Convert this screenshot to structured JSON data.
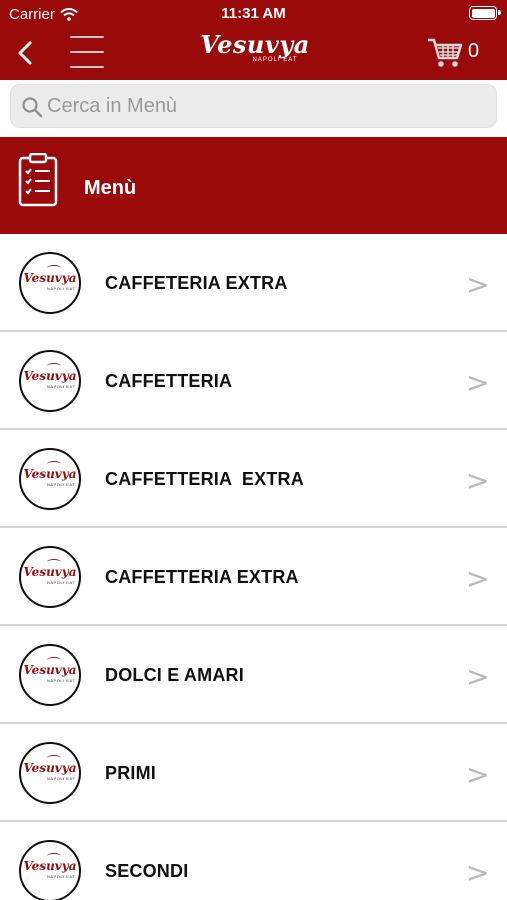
{
  "status_bar": {
    "carrier": "Carrier",
    "time": "11:31 AM"
  },
  "nav": {
    "logo_text": "Vesuvya",
    "logo_subtext": "NAPOLI EAT",
    "cart_count": "0"
  },
  "search": {
    "placeholder": "Cerca in Menù"
  },
  "menu_header": {
    "title": "Menù"
  },
  "categories": [
    {
      "label": "CAFFETERIA EXTRA"
    },
    {
      "label": "CAFFETTERIA"
    },
    {
      "label": "CAFFETTERIA  EXTRA"
    },
    {
      "label": "CAFFETTERIA EXTRA"
    },
    {
      "label": "DOLCI E AMARI"
    },
    {
      "label": "PRIMI"
    },
    {
      "label": "SECONDI"
    }
  ],
  "row_chevron": ">",
  "colors": {
    "brand_red": "#9b0a0a",
    "divider": "#d3d3d3",
    "chevron": "#b9b9b9"
  }
}
